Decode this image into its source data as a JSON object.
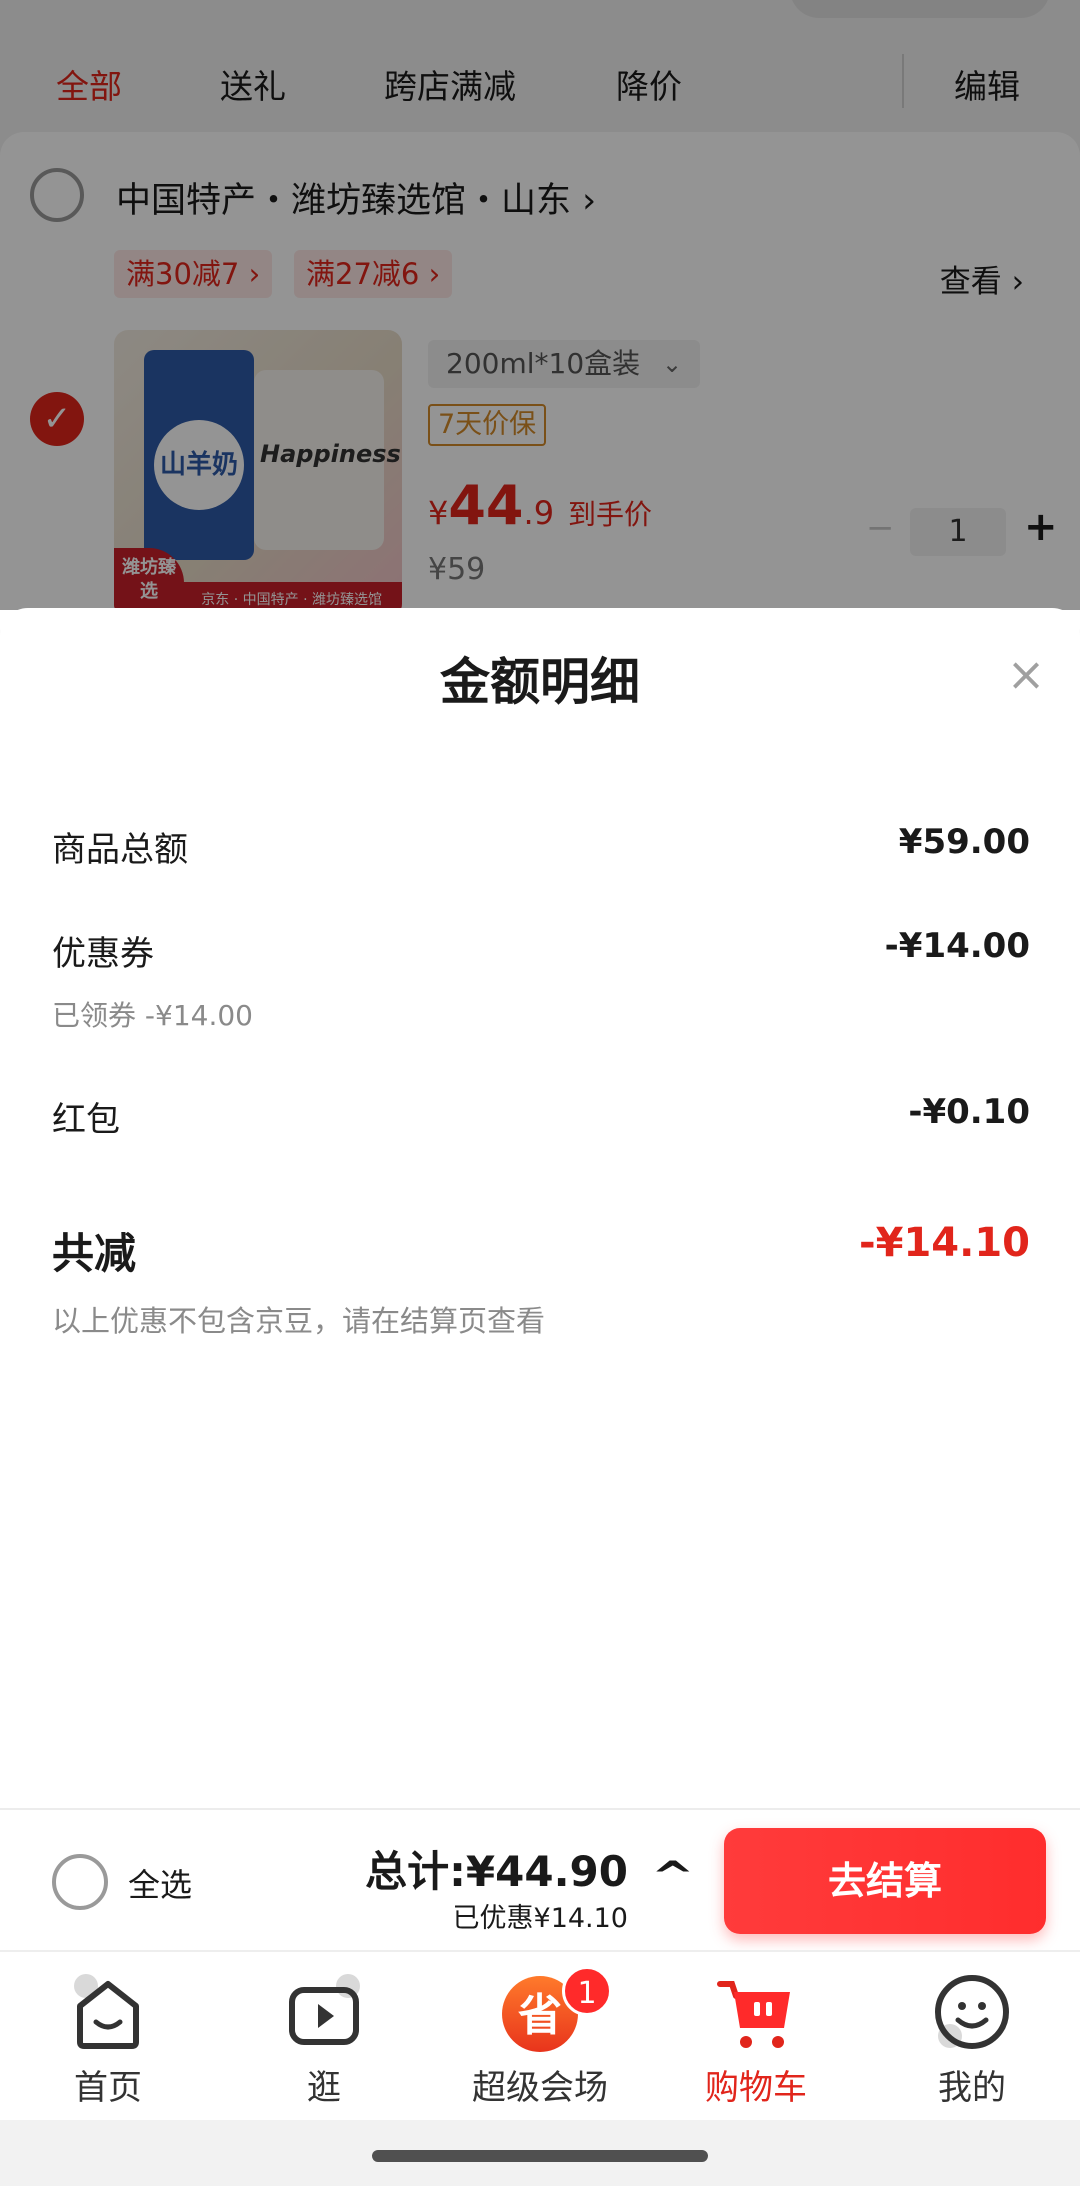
{
  "filter_tabs": [
    {
      "label": "全部",
      "active": true
    },
    {
      "label": "送礼",
      "active": false
    },
    {
      "label": "跨店满减",
      "active": false
    },
    {
      "label": "降价",
      "active": false
    }
  ],
  "edit_label": "编辑",
  "store": {
    "name": "中国特产・潍坊臻选馆・山东 ›",
    "promos": [
      "满30减7 ›",
      "满27减6 ›"
    ],
    "view_label": "查看 ›"
  },
  "product": {
    "image_texts": {
      "bottle_label": "山羊奶",
      "cup_text": "Happiness",
      "banner": "京东 · 中国特产 · 潍坊臻选馆",
      "badge": "潍坊臻选"
    },
    "spec": "200ml*10盒装",
    "guarantee": "7天价保",
    "price_yen": "¥",
    "price_int": "44",
    "price_dec": ".9",
    "price_tag": "到手价",
    "original_price": "¥59",
    "quantity": "1"
  },
  "sheet": {
    "title": "金额明细",
    "rows": [
      {
        "label": "商品总额",
        "value": "¥59.00"
      },
      {
        "label": "优惠券",
        "value": "-¥14.00",
        "sub": "已领券 -¥14.00"
      },
      {
        "label": "红包",
        "value": "-¥0.10"
      }
    ],
    "total_label": "共减",
    "total_value": "-¥14.10",
    "note": "以上优惠不包含京豆，请在结算页查看"
  },
  "checkout": {
    "select_all": "全选",
    "total": "总计:¥44.90",
    "saved": "已优惠¥14.10",
    "button": "去结算"
  },
  "tabs": [
    {
      "label": "首页",
      "icon": "home-icon"
    },
    {
      "label": "逛",
      "icon": "video-icon"
    },
    {
      "label": "超级会场",
      "icon": "super-venue-icon",
      "badge": "1",
      "glyph": "省"
    },
    {
      "label": "购物车",
      "icon": "cart-icon",
      "active": true
    },
    {
      "label": "我的",
      "icon": "profile-icon"
    }
  ],
  "colors": {
    "accent": "#e1251b",
    "button": "#ff2d2d"
  }
}
